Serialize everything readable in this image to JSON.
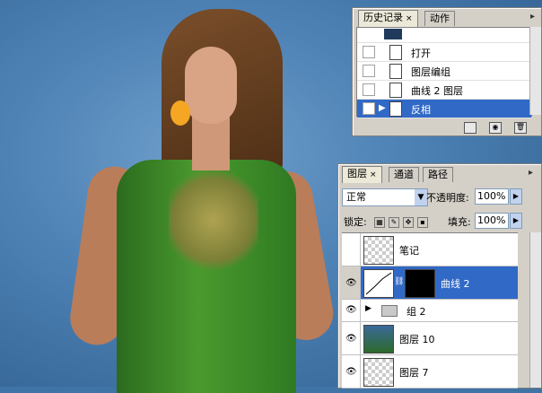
{
  "history_panel": {
    "tabs": [
      {
        "label": "历史记录",
        "active": true
      },
      {
        "label": "动作",
        "active": false
      }
    ],
    "close_glyph": "×",
    "items": [
      {
        "label": "打开",
        "selected": false
      },
      {
        "label": "图层编组",
        "selected": false
      },
      {
        "label": "曲线 2 图层",
        "selected": false
      },
      {
        "label": "反相",
        "selected": true
      }
    ],
    "bottom_icons": [
      "new-document-icon",
      "camera-snapshot-icon",
      "trash-icon"
    ]
  },
  "layers_panel": {
    "tabs": [
      {
        "label": "图层",
        "active": true
      },
      {
        "label": "通道",
        "active": false
      },
      {
        "label": "路径",
        "active": false
      }
    ],
    "close_glyph": "×",
    "blend_mode": "正常",
    "opacity_label": "不透明度:",
    "opacity_value": "100%",
    "lock_label": "锁定:",
    "fill_label": "填充:",
    "fill_value": "100%",
    "layers": [
      {
        "name": "笔记",
        "visible": false,
        "selected": false,
        "type": "transparent"
      },
      {
        "name": "曲线 2",
        "visible": true,
        "selected": true,
        "type": "adjustment"
      },
      {
        "name": "组 2",
        "visible": true,
        "selected": false,
        "type": "group"
      },
      {
        "name": "图层 10",
        "visible": true,
        "selected": false,
        "type": "photo"
      },
      {
        "name": "图层 7",
        "visible": true,
        "selected": false,
        "type": "transparent"
      }
    ]
  },
  "colors": {
    "selection": "#3169c6",
    "panel_bg": "#d4d0c8",
    "canvas_bg": "#3f74a6"
  }
}
